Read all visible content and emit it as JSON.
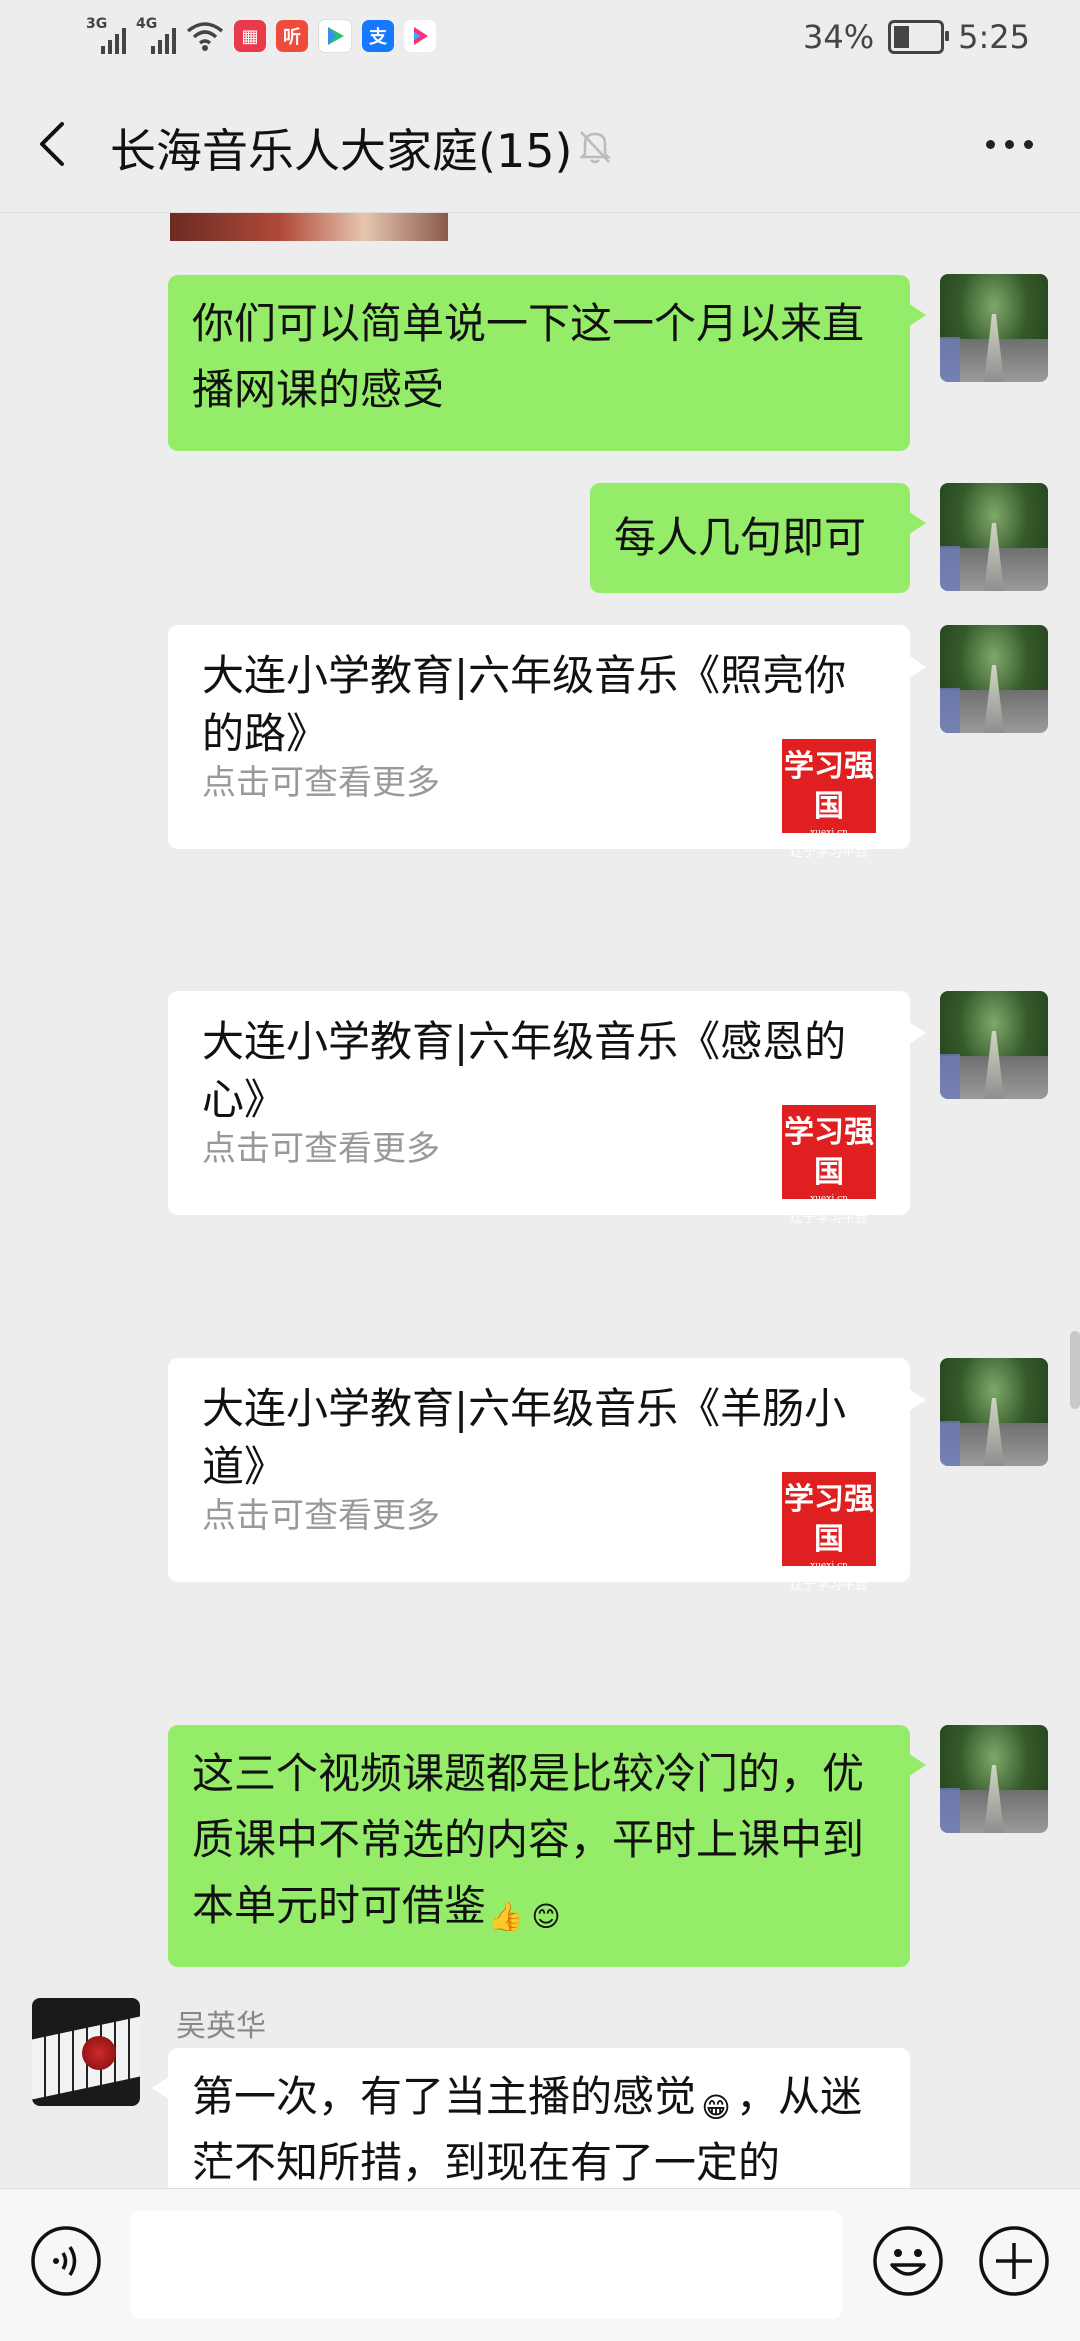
{
  "status_bar": {
    "network1": "3G",
    "network2": "4G",
    "battery_percent": "34%",
    "battery_level": 0.34,
    "time": "5:25",
    "app_icons": [
      "calendar-app-icon",
      "ting-app-icon",
      "video-app-icon",
      "alipay-app-icon",
      "youku-app-icon"
    ],
    "ting_label": "听"
  },
  "header": {
    "title": "长海音乐人大家庭(15)",
    "muted": true
  },
  "messages": [
    {
      "id": "m1",
      "side": "right",
      "type": "text",
      "text": "你们可以简单说一下这一个月以来直播网课的感受"
    },
    {
      "id": "m2",
      "side": "right",
      "type": "text",
      "text": "每人几句即可"
    },
    {
      "id": "m3",
      "side": "right",
      "type": "link",
      "title": "大连小学教育|六年级音乐《照亮你的路》",
      "subtitle": "点击可查看更多",
      "logo": {
        "line1": "学习强国",
        "line2": "xuexi.cn",
        "line3": "辽宁学习平台"
      }
    },
    {
      "id": "m4",
      "side": "right",
      "type": "link",
      "title": "大连小学教育|六年级音乐《感恩的心》",
      "subtitle": "点击可查看更多",
      "logo": {
        "line1": "学习强国",
        "line2": "xuexi.cn",
        "line3": "辽宁学习平台"
      }
    },
    {
      "id": "m5",
      "side": "right",
      "type": "link",
      "title": "大连小学教育|六年级音乐《羊肠小道》",
      "subtitle": "点击可查看更多",
      "logo": {
        "line1": "学习强国",
        "line2": "xuexi.cn",
        "line3": "辽宁学习平台"
      }
    },
    {
      "id": "m6",
      "side": "right",
      "type": "text",
      "text": "这三个视频课题都是比较冷门的，优质课中不常选的内容，平时上课中到本单元时可借鉴",
      "emojis": [
        "👍",
        "😊"
      ]
    },
    {
      "id": "m7",
      "side": "left",
      "type": "text",
      "sender": "吴英华",
      "text_before": "第一次，有了当主播的感觉",
      "emoji": "😁",
      "text_after": "，从迷茫不知所措，到现在有了一定的"
    }
  ],
  "input_bar": {
    "voice_icon": "voice-icon",
    "emoji_icon": "emoji-icon",
    "plus_icon": "plus-icon"
  }
}
